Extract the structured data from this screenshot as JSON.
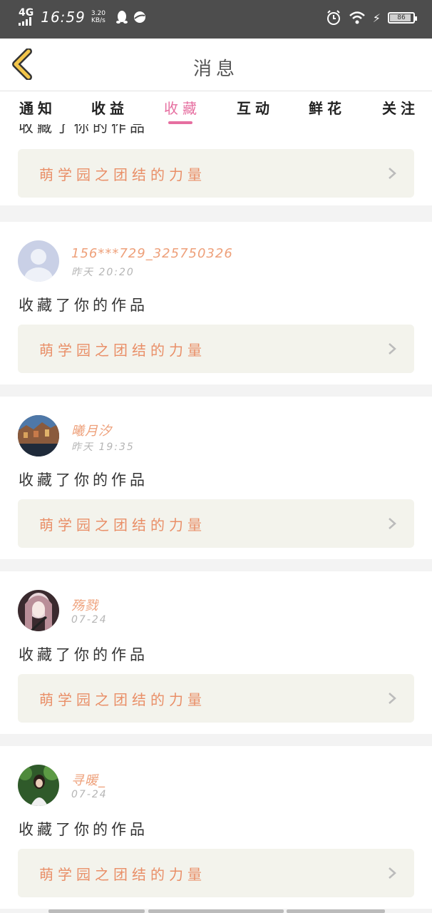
{
  "status_bar": {
    "network": "4G",
    "time": "16:59",
    "speed_value": "3.20",
    "speed_unit": "KB/s",
    "battery": "86"
  },
  "header": {
    "title": "消息",
    "back_icon": "chevron-left-icon"
  },
  "tabs": [
    {
      "label": "通知",
      "active": false
    },
    {
      "label": "收益",
      "active": false
    },
    {
      "label": "收藏",
      "active": true
    },
    {
      "label": "互动",
      "active": false
    },
    {
      "label": "鲜花",
      "active": false
    },
    {
      "label": "关注",
      "active": false
    }
  ],
  "colors": {
    "accent": "#e66fa0",
    "username": "#eea07a",
    "work_title": "#e98f68",
    "work_bg": "#f3f3ec"
  },
  "partial_item": {
    "action": "收藏了你的作品",
    "work_title": "萌学园之团结的力量"
  },
  "items": [
    {
      "username": "156***729_325750326",
      "time": "昨天 20:20",
      "action": "收藏了你的作品",
      "work_title": "萌学园之团结的力量",
      "avatar": "default-avatar"
    },
    {
      "username": "曦月汐",
      "time": "昨天 19:35",
      "action": "收藏了你的作品",
      "work_title": "萌学园之团结的力量",
      "avatar": "landscape-avatar"
    },
    {
      "username": "殇戮",
      "time": "07-24",
      "action": "收藏了你的作品",
      "work_title": "萌学园之团结的力量",
      "avatar": "anime-avatar"
    },
    {
      "username": "寻暖_",
      "time": "07-24",
      "action": "收藏了你的作品",
      "work_title": "萌学园之团结的力量",
      "avatar": "girl-avatar"
    }
  ]
}
